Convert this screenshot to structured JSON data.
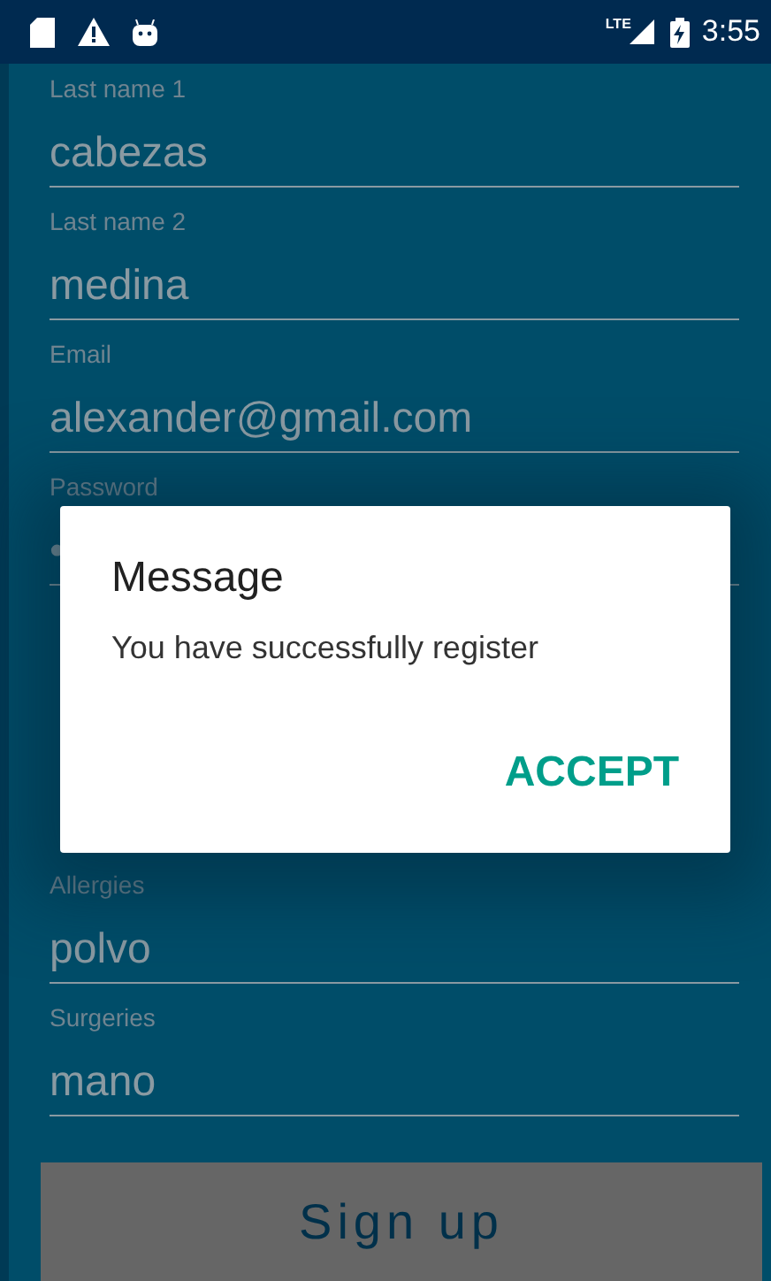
{
  "status_bar": {
    "network": "LTE",
    "time": "3:55"
  },
  "form": {
    "sections": [
      [
        {
          "kind": "field",
          "label": "Last name 1",
          "value": "cabezas"
        },
        {
          "kind": "field",
          "label": "Last name 2",
          "value": "medina"
        },
        {
          "kind": "field",
          "label": "Email",
          "value": "alexander@gmail.com"
        },
        {
          "kind": "field",
          "label": "Password",
          "value": "•"
        }
      ],
      [
        {
          "kind": "field",
          "label": "Allergies",
          "value": "polvo"
        },
        {
          "kind": "field",
          "label": "Surgeries",
          "value": "mano"
        }
      ]
    ],
    "submit": "Sign up"
  },
  "dialog": {
    "title": "Message",
    "message": "You have successfully register",
    "button": "ACCEPT"
  }
}
